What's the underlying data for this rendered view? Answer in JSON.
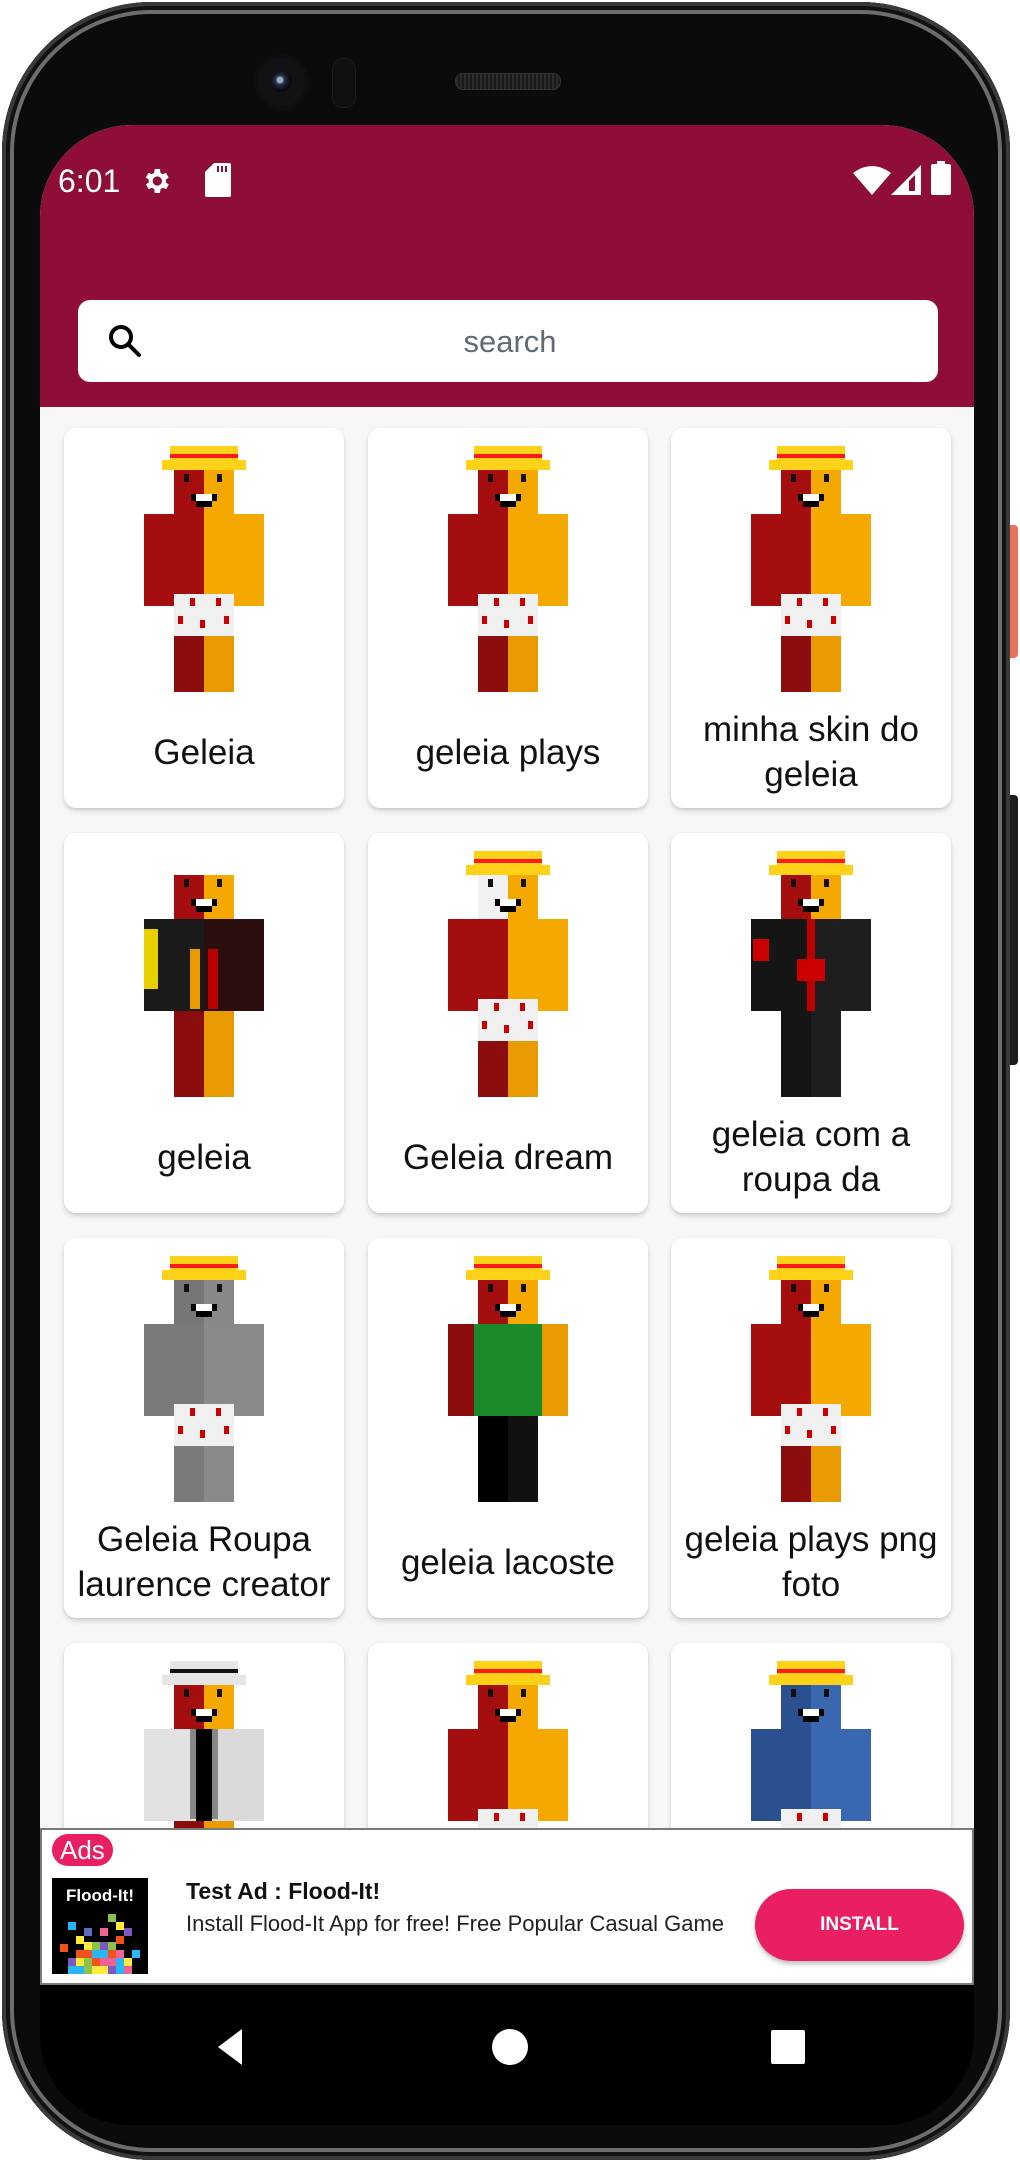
{
  "status_bar": {
    "time": "6:01",
    "left_icons": [
      "gear-icon",
      "sd-card-icon"
    ],
    "right_icons": [
      "wifi-icon",
      "cell-signal-icon",
      "battery-icon"
    ]
  },
  "theme": {
    "appbar_color": "#8e0e38",
    "accent_color": "#e91e63",
    "background": "#f7f7f7"
  },
  "search": {
    "placeholder": "search",
    "value": "",
    "icon": "search-icon"
  },
  "skins": [
    {
      "label": "Geleia",
      "style": "redyellow",
      "hat": "yellow"
    },
    {
      "label": "geleia plays",
      "style": "redyellow",
      "hat": "yellow"
    },
    {
      "label": "minha skin do geleia",
      "style": "redyellow",
      "hat": "yellow"
    },
    {
      "label": "geleia",
      "style": "armor",
      "hat": "none"
    },
    {
      "label": "Geleia dream",
      "style": "dream",
      "hat": "yellow"
    },
    {
      "label": "geleia com a roupa da",
      "style": "akatsuki",
      "hat": "yellow"
    },
    {
      "label": "Geleia Roupa laurence creator",
      "style": "grid",
      "hat": "yellow"
    },
    {
      "label": "geleia lacoste",
      "style": "lacoste",
      "hat": "yellow"
    },
    {
      "label": "geleia plays png foto",
      "style": "redyellow",
      "hat": "yellow"
    },
    {
      "label": "",
      "style": "suit",
      "hat": "white"
    },
    {
      "label": "",
      "style": "redyellow",
      "hat": "yellow"
    },
    {
      "label": "",
      "style": "blue",
      "hat": "yellow"
    }
  ],
  "ad": {
    "badge": "Ads",
    "icon_title": "Flood-It!",
    "title": "Test Ad : Flood-It!",
    "description": "Install Flood-It App for free! Free Popular Casual Game",
    "button": "INSTALL"
  },
  "navigation": {
    "back": "back-icon",
    "home": "home-icon",
    "recents": "recents-icon"
  }
}
